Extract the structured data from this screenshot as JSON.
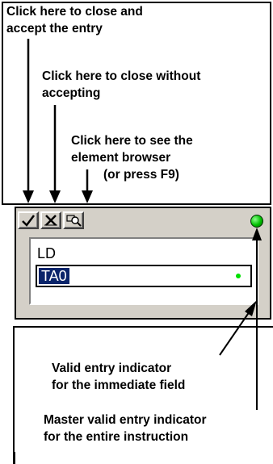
{
  "callouts": {
    "close_accept": "Click here to close and\naccept the entry",
    "close_cancel": "Click here to close without\naccepting",
    "browser_line1": "Click here to see the\nelement browser",
    "browser_line2": "(or press F9)",
    "valid_immediate": "Valid entry indicator\nfor the immediate field",
    "master_valid": "Master valid entry indicator\nfor the entire instruction"
  },
  "editor": {
    "opcode": "LD",
    "operand_value": "TA0",
    "icons": {
      "accept": "checkmark-icon",
      "cancel": "cancel-x-icon",
      "browser": "element-browser-icon",
      "master_indicator": "green-led-icon",
      "immediate_indicator": "green-dot-icon"
    },
    "colors": {
      "panel": "#d4d0c8",
      "selection": "#0a246a",
      "valid": "#00c000"
    }
  }
}
